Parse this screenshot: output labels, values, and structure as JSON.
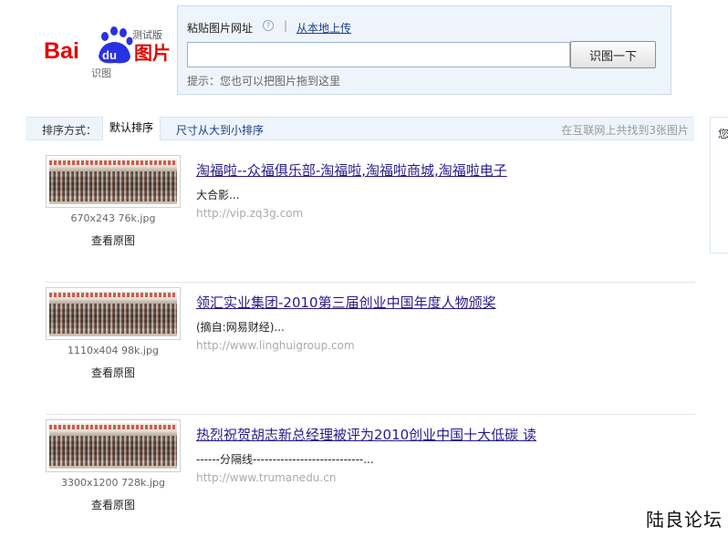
{
  "logo": {
    "brand": "Bai du",
    "product": "图片",
    "beta": "测试版",
    "subtitle": "识图",
    "colors": {
      "red": "#e10601",
      "blue": "#2932e1"
    }
  },
  "search": {
    "paste_label": "粘贴图片网址",
    "help_icon": "question-circle-icon",
    "divider": "|",
    "upload_link": "从本地上传",
    "input_value": "",
    "input_placeholder": "",
    "button_label": "识图一下",
    "hint": "提示：您也可以把图片拖到这里"
  },
  "sort": {
    "label": "排序方式：",
    "default_option": "默认排序",
    "size_option": "尺寸从大到小排序",
    "result_count": "在互联网上共找到3张图片"
  },
  "side_panel": {
    "text": "您"
  },
  "results": [
    {
      "size": "670x243 76k.jpg",
      "view_label": "查看原图",
      "title": "淘福啦--众福俱乐部-淘福啦,淘福啦商城,淘福啦电子",
      "snippet": "大合影...",
      "url": "http://vip.zq3g.com"
    },
    {
      "size": "1110x404 98k.jpg",
      "view_label": "查看原图",
      "title": "领汇实业集团-2010第三届创业中国年度人物颁奖",
      "snippet": "(摘自:网易财经)...",
      "url": "http://www.linghuigroup.com"
    },
    {
      "size": "3300x1200 728k.jpg",
      "view_label": "查看原图",
      "title": "热烈祝贺胡志新总经理被评为2010创业中国十大低碳 读",
      "snippet": "------分隔线----------------------------...",
      "url": "http://www.trumanedu.cn"
    }
  ],
  "watermark": "陆良论坛"
}
